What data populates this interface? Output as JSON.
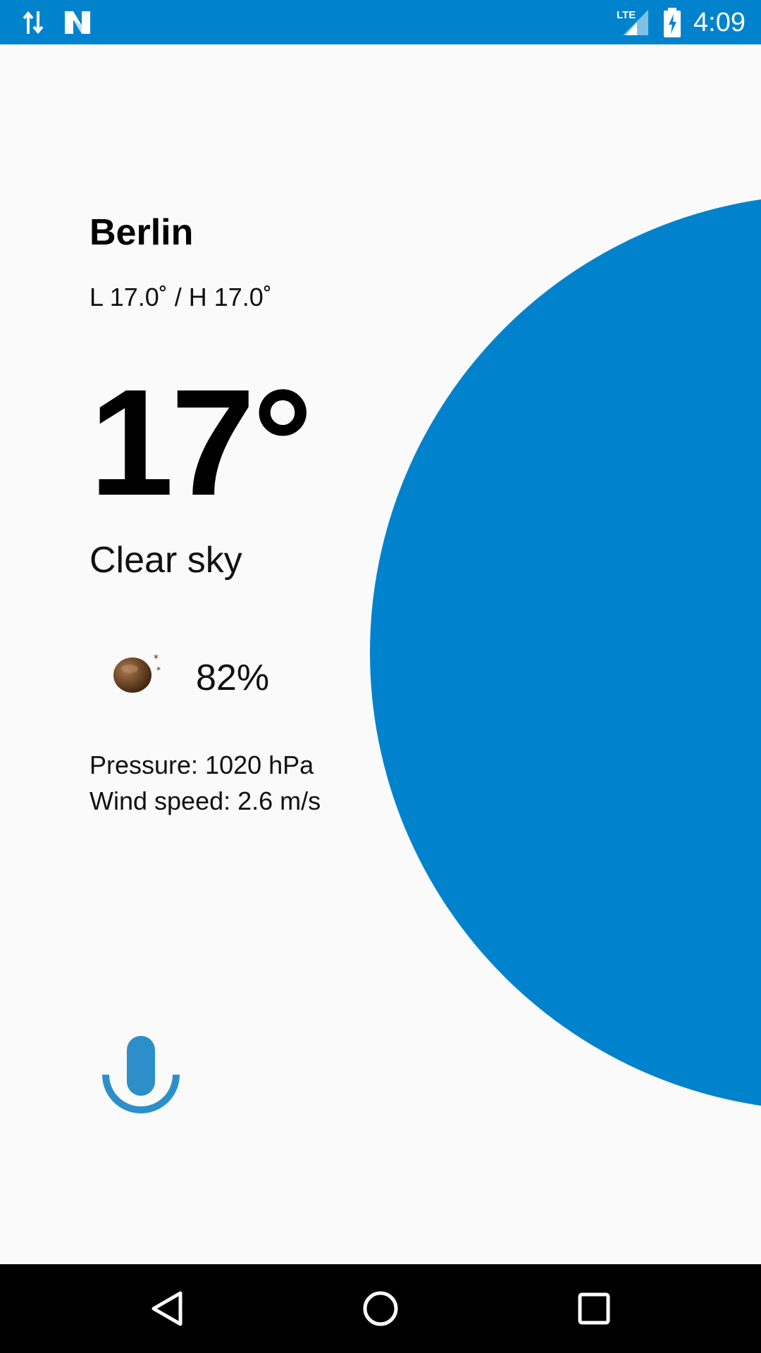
{
  "status_bar": {
    "time": "4:09",
    "network_label": "LTE",
    "icons": [
      "data-transfer-icon",
      "n-notification-icon",
      "lte-signal-icon",
      "battery-charging-icon"
    ],
    "color": "#0083cc"
  },
  "weather": {
    "city": "Berlin",
    "low_high": "L 17.0˚ / H 17.0˚",
    "temperature": "17°",
    "description": "Clear sky",
    "humidity": "82%",
    "pressure": "Pressure: 1020 hPa",
    "wind_speed": "Wind speed: 2.6 m/s"
  },
  "voice": {
    "icon": "microphone-icon",
    "color": "#2c8fc9"
  },
  "nav_bar": {
    "buttons": [
      "back-icon",
      "home-icon",
      "recents-icon"
    ]
  },
  "colors": {
    "accent": "#0083cc",
    "background": "#fafafa"
  }
}
